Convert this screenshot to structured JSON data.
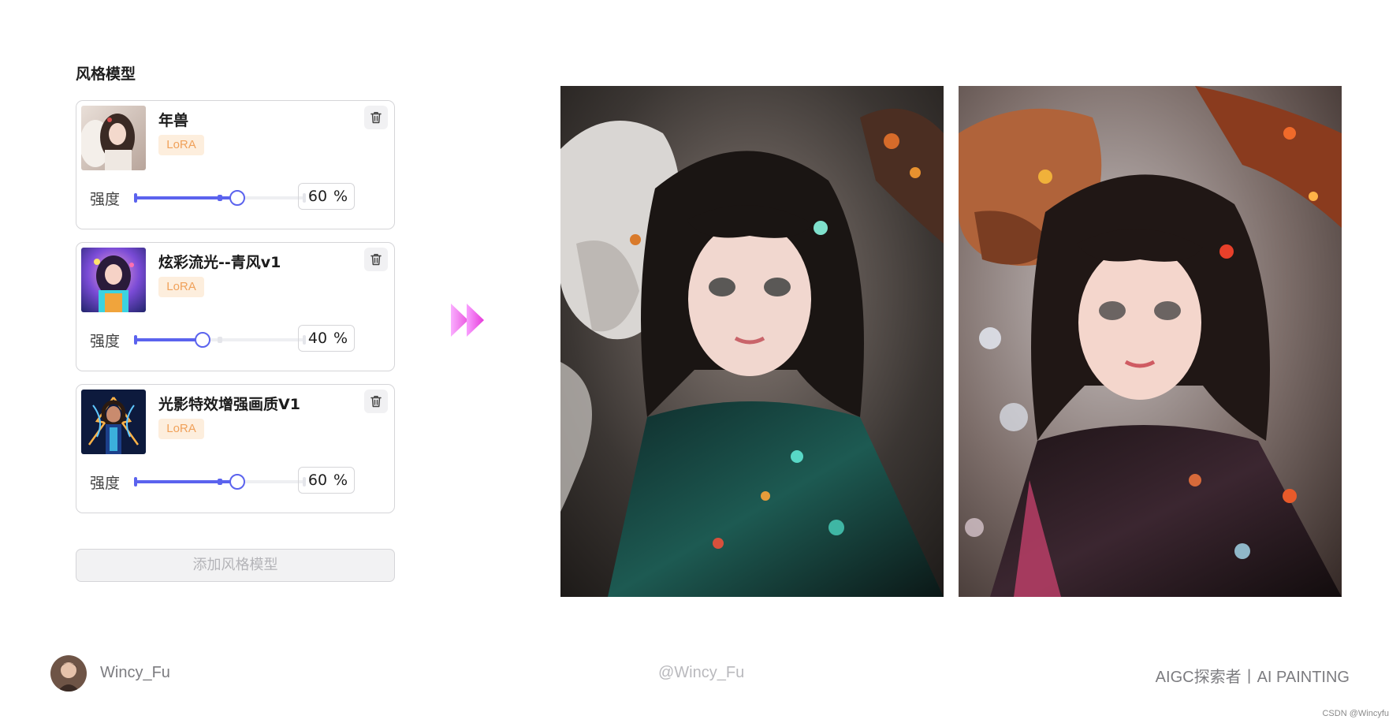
{
  "panel": {
    "title": "风格模型",
    "strength_label": "强度",
    "unit": "%",
    "models": [
      {
        "name": "年兽",
        "badge": "LoRA",
        "strength": 60
      },
      {
        "name": "炫彩流光--青风v1",
        "badge": "LoRA",
        "strength": 40
      },
      {
        "name": "光影特效增强画质V1",
        "badge": "LoRA",
        "strength": 60
      }
    ],
    "add_button": "添加风格模型"
  },
  "colors": {
    "accent": "#5b63ee",
    "badge_text": "#f0a15a",
    "badge_bg": "#fdeedd",
    "arrow": "#ec4fe6"
  },
  "icons": {
    "delete": "trash-icon",
    "arrow": "double-chevron-right-icon"
  },
  "footer": {
    "author": "Wincy_Fu",
    "handle": "@Wincy_Fu",
    "tagline": "AIGC探索者丨AI PAINTING",
    "watermark": "CSDN @Wincyfu"
  }
}
